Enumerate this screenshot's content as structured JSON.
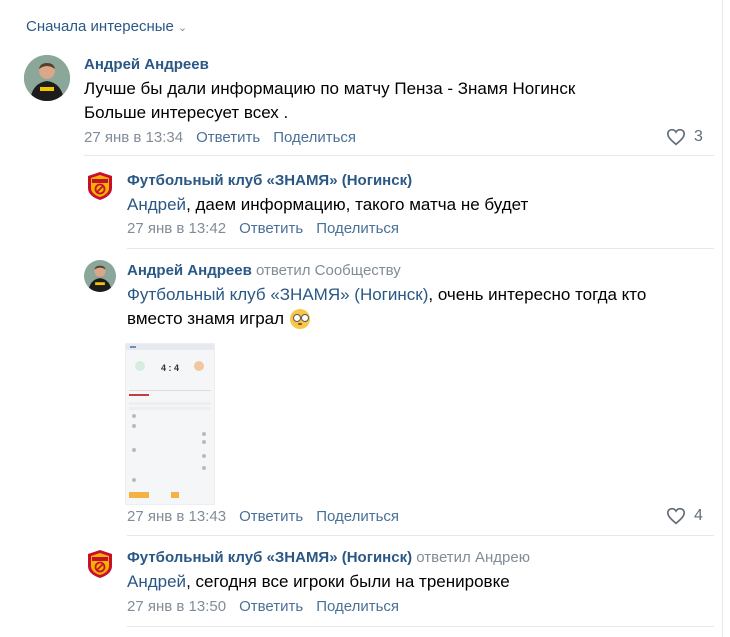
{
  "sort": {
    "label": "Сначала интересные"
  },
  "comments": [
    {
      "author": "Андрей Андреев",
      "text_line1": "Лучше бы дали информацию по матчу Пенза - Знамя Ногинск",
      "text_line2": "Больше интересует всех .",
      "date": "27 янв в 13:34",
      "reply": "Ответить",
      "share": "Поделиться",
      "likes": "3"
    },
    {
      "author": "Футбольный клуб «ЗНАМЯ» (Ногинск)",
      "mention": "Андрей",
      "text": ", даем информацию, такого матча не будет",
      "date": "27 янв в 13:42",
      "reply": "Ответить",
      "share": "Поделиться"
    },
    {
      "author": "Андрей Андреев",
      "replied_to": "ответил Сообществу",
      "mention": "Футбольный клуб «ЗНАМЯ» (Ногинск)",
      "text_line1": ", очень интересно тогда кто",
      "text_line2": "вместо знамя играл",
      "attachment": {
        "score": "4 : 4"
      },
      "date": "27 янв в 13:43",
      "reply": "Ответить",
      "share": "Поделиться",
      "likes": "4"
    },
    {
      "author": "Футбольный клуб «ЗНАМЯ» (Ногинск)",
      "replied_to": "ответил Андрею",
      "mention": "Андрей",
      "text": ", сегодня все игроки были на тренировке",
      "date": "27 янв в 13:50",
      "reply": "Ответить",
      "share": "Поделиться"
    }
  ],
  "colors": {
    "link": "#2a5885",
    "meta": "#818c99",
    "club_red": "#c8102e",
    "club_yellow": "#f5b400"
  }
}
